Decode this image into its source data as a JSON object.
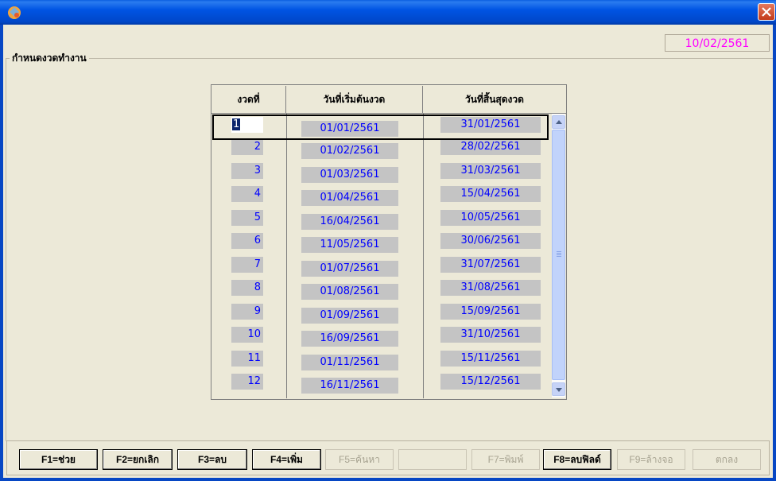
{
  "window": {
    "close_icon": "close-icon",
    "app_icon": "app-icon"
  },
  "current_date": "10/02/2561",
  "group_title": "กำหนดงวดทำงาน",
  "table": {
    "headers": [
      "งวดที่",
      "วันที่เริ่มต้นงวด",
      "วันที่สิ้นสุดงวด"
    ],
    "rows": [
      {
        "num": "1",
        "start": "01/01/2561",
        "end": "31/01/2561"
      },
      {
        "num": "2",
        "start": "01/02/2561",
        "end": "28/02/2561"
      },
      {
        "num": "3",
        "start": "01/03/2561",
        "end": "31/03/2561"
      },
      {
        "num": "4",
        "start": "01/04/2561",
        "end": "15/04/2561"
      },
      {
        "num": "5",
        "start": "16/04/2561",
        "end": "10/05/2561"
      },
      {
        "num": "6",
        "start": "11/05/2561",
        "end": "30/06/2561"
      },
      {
        "num": "7",
        "start": "01/07/2561",
        "end": "31/07/2561"
      },
      {
        "num": "8",
        "start": "01/08/2561",
        "end": "31/08/2561"
      },
      {
        "num": "9",
        "start": "01/09/2561",
        "end": "15/09/2561"
      },
      {
        "num": "10",
        "start": "16/09/2561",
        "end": "31/10/2561"
      },
      {
        "num": "11",
        "start": "01/11/2561",
        "end": "15/11/2561"
      },
      {
        "num": "12",
        "start": "16/11/2561",
        "end": "15/12/2561"
      }
    ]
  },
  "toolbar": {
    "f1": "F1=ช่วย",
    "f2": "F2=ยกเลิก",
    "f3": "F3=ลบ",
    "f4": "F4=เพิ่ม",
    "f5": "F5=ค้นหา",
    "blank": "",
    "f7": "F7=พิมพ์",
    "f8": "F8=ลบฟิลด์",
    "f9": "F9=ล้างจอ",
    "ok": "ตกลง"
  },
  "colors": {
    "title_bar": "#0054e3",
    "background": "#ece9d8",
    "cell_text": "#0000ff",
    "date_text": "#ff00ff"
  }
}
